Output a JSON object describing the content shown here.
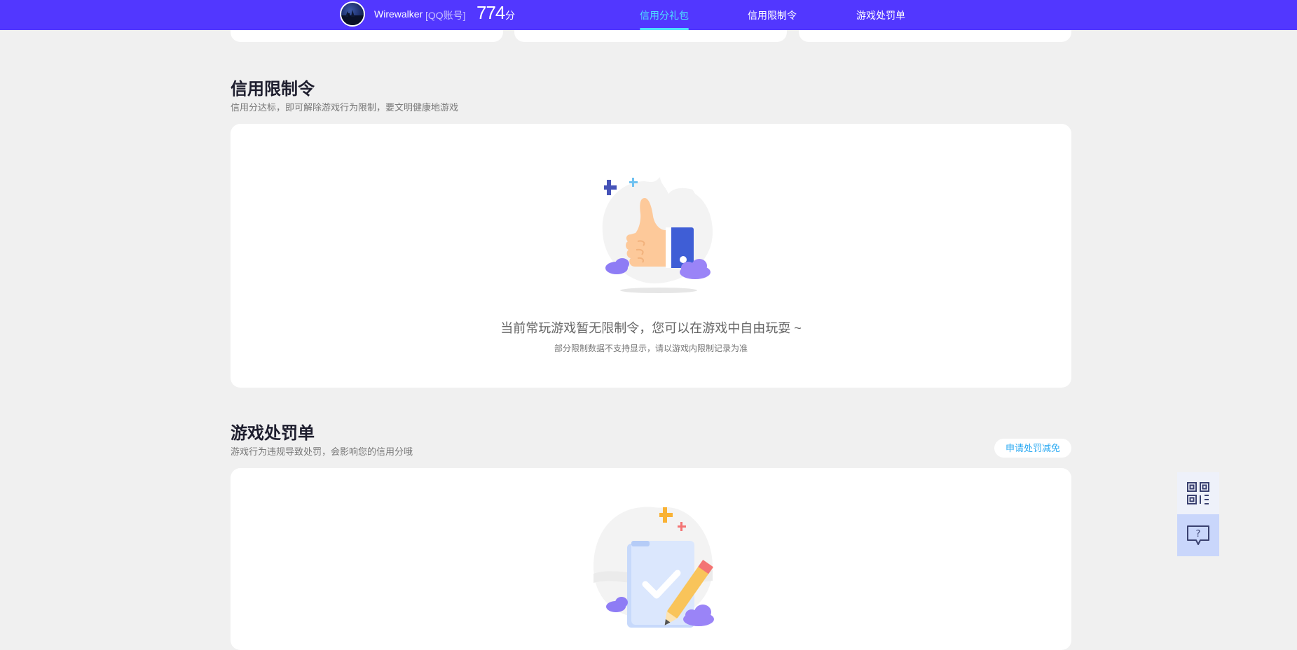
{
  "header": {
    "username": "Wirewalker",
    "account_type": "[QQ账号]",
    "score": "774",
    "score_unit": "分",
    "tabs": [
      {
        "label": "信用分礼包",
        "active": true
      },
      {
        "label": "信用限制令",
        "active": false
      },
      {
        "label": "游戏处罚单",
        "active": false
      }
    ],
    "accent_color": "#5237ff",
    "active_tab_color": "#4de0ff"
  },
  "restrictions": {
    "title": "信用限制令",
    "subtitle": "信用分达标，即可解除游戏行为限制，要文明健康地游戏",
    "empty_message": "当前常玩游戏暂无限制令，您可以在游戏中自由玩耍 ~",
    "empty_note": "部分限制数据不支持显示，请以游戏内限制记录为准",
    "illustration": "thumbs-up-icon"
  },
  "penalties": {
    "title": "游戏处罚单",
    "subtitle": "游戏行为违规导致处罚，会影响您的信用分哦",
    "apply_button": "申请处罚减免",
    "illustration": "clipboard-check-icon"
  },
  "side_tools": [
    {
      "name": "qr-code-icon"
    },
    {
      "name": "help-chat-icon"
    }
  ]
}
